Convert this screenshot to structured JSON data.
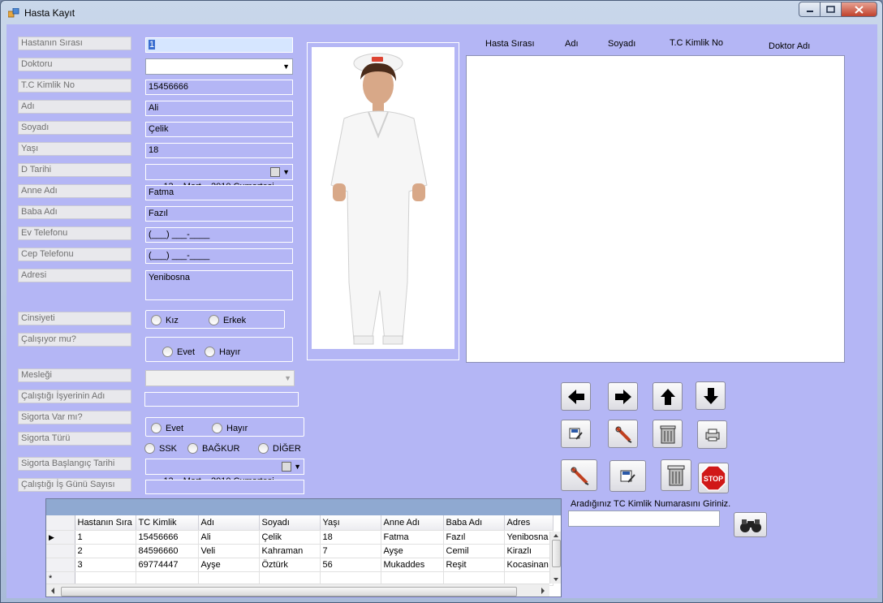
{
  "window": {
    "title": "Hasta Kayıt"
  },
  "form": {
    "labels": {
      "sira": "Hastanın Sırası",
      "doktor": "Doktoru",
      "tc": "T.C Kimlik No",
      "adi": "Adı",
      "soyadi": "Soyadı",
      "yasi": "Yaşı",
      "dtarihi": "D Tarihi",
      "anne": "Anne Adı",
      "baba": "Baba Adı",
      "evtel": "Ev Telefonu",
      "ceptel": "Cep Telefonu",
      "adres": "Adresi",
      "cinsiyet": "Cinsiyeti",
      "calisiyor": "Çalışıyor mu?",
      "meslek": "Mesleği",
      "isyeri": "Çalıştığı İşyerinin Adı",
      "sigorta_var": "Sigorta Var mı?",
      "sigorta_turu": "Sigorta Türü",
      "sigorta_baslangic": "Sigorta Başlangıç Tarihi",
      "isgunu": "Çalıştığı İş Günü Sayısı"
    },
    "values": {
      "sira": "1",
      "doktor": "",
      "tc": "15456666",
      "adi": "Ali",
      "soyadi": "Çelik",
      "yasi": "18",
      "dtarihi": "13    Mart    2010 Cumartesi",
      "anne": "Fatma",
      "baba": "Fazıl",
      "evtel": "(___) ___-____",
      "ceptel": "(___) ___-____",
      "adres": "Yenibosna",
      "meslek": "",
      "isyeri": "",
      "sigorta_baslangic": "13    Mart    2010 Cumartesi",
      "isgunu": ""
    },
    "radios": {
      "kiz": "Kız",
      "erkek": "Erkek",
      "evet": "Evet",
      "hayir": "Hayır",
      "sig_evet": "Evet",
      "sig_hayir": "Hayır",
      "ssk": "SSK",
      "bagkur": "BAĞKUR",
      "diger": "DİĞER"
    }
  },
  "list": {
    "headers": [
      "Hasta Sırası",
      "Adı",
      "Soyadı",
      "T.C Kimlik No",
      "Doktor Adı"
    ]
  },
  "grid": {
    "columns": [
      "Hastanın Sıra",
      "TC Kimlik",
      "Adı",
      "Soyadı",
      "Yaşı",
      "Anne Adı",
      "Baba Adı",
      "Adres"
    ],
    "rows": [
      [
        "1",
        "15456666",
        "Ali",
        "Çelik",
        "18",
        "Fatma",
        "Fazıl",
        "Yenibosna"
      ],
      [
        "2",
        "84596660",
        "Veli",
        "Kahraman",
        "7",
        "Ayşe",
        "Cemil",
        "Kirazlı"
      ],
      [
        "3",
        "69774447",
        "Ayşe",
        "Öztürk",
        "56",
        "Mukaddes",
        "Reşit",
        "Kocasinan"
      ]
    ],
    "new_row_marker": "*",
    "current_row_marker": "▶"
  },
  "search": {
    "label": "Aradığınız TC Kimlik Numarasını Giriniz.",
    "value": ""
  },
  "buttons": {
    "stop_label": "STOP"
  },
  "colors": {
    "client_bg": "#b4b6f5",
    "stop_red": "#d01818"
  }
}
